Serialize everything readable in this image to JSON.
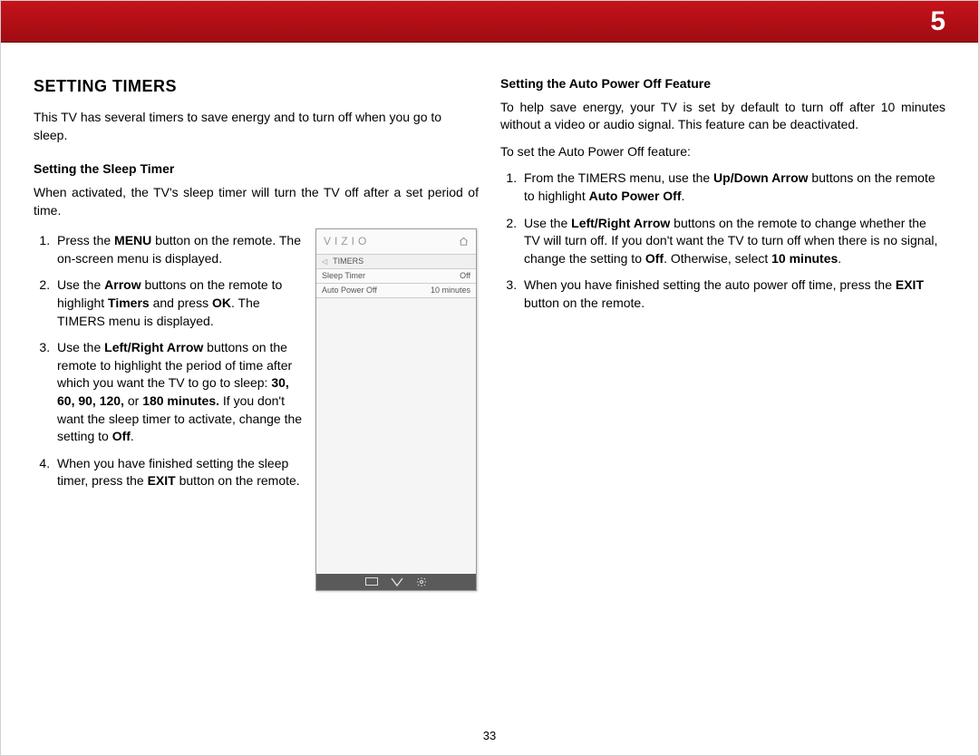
{
  "chapter_number": "5",
  "page_number": "33",
  "section_title": "SETTING TIMERS",
  "intro": "This TV has several timers to save energy and to turn off when you go to sleep.",
  "left": {
    "subhead": "Setting the Sleep Timer",
    "para": "When activated, the TV's sleep timer will turn the TV off after a set period of time.",
    "steps": {
      "s1a": "Press the ",
      "s1b": "MENU",
      "s1c": " button on the remote. The on-screen menu is displayed.",
      "s2a": "Use the ",
      "s2b": "Arrow",
      "s2c": " buttons on the remote to highlight ",
      "s2d": "Timers",
      "s2e": " and press ",
      "s2f": "OK",
      "s2g": ". The TIMERS menu is displayed.",
      "s3a": "Use the ",
      "s3b": "Left/Right Arrow",
      "s3c": " buttons on the remote to highlight the period of time after which you want the TV to go to sleep: ",
      "s3d": "30, 60, 90, 120,",
      "s3e": " or ",
      "s3f": "180 minutes.",
      "s3g": " If you don't want the sleep timer to activate, change the setting to ",
      "s3h": "Off",
      "s3i": ".",
      "s4a": "When you have finished setting the sleep timer, press the ",
      "s4b": "EXIT",
      "s4c": " button on the remote."
    }
  },
  "right": {
    "subhead": "Setting the Auto Power Off Feature",
    "para1": "To help save energy, your TV is set by default to turn off after 10 minutes without a video or audio signal. This feature can be deactivated.",
    "para2": "To set the Auto Power Off feature:",
    "steps": {
      "s1a": "From the TIMERS menu, use the ",
      "s1b": "Up/Down Arrow",
      "s1c": " buttons on the remote to highlight ",
      "s1d": "Auto Power Off",
      "s1e": ".",
      "s2a": "Use the ",
      "s2b": "Left/Right Arrow",
      "s2c": " buttons on the remote to change whether the TV will turn off. If you don't want the TV to turn off when there is no signal, change the setting to ",
      "s2d": "Off",
      "s2e": ". Otherwise, select ",
      "s2f": "10 minutes",
      "s2g": ".",
      "s3a": "When you have finished setting the auto power off time, press the ",
      "s3b": "EXIT",
      "s3c": " button on the remote."
    }
  },
  "menu": {
    "brand": "VIZIO",
    "title": "TIMERS",
    "row1_label": "Sleep Timer",
    "row1_value": "Off",
    "row2_label": "Auto Power Off",
    "row2_value": "10 minutes"
  }
}
